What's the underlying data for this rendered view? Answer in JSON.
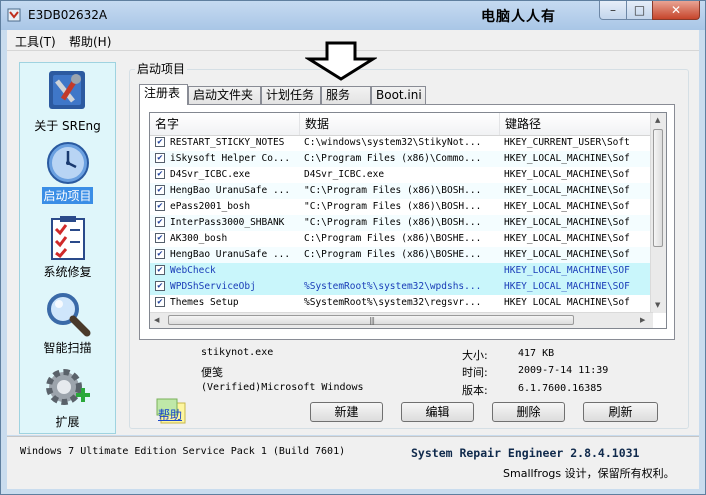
{
  "window": {
    "title": "E3DB02632A",
    "overlay_title": "电脑人人有",
    "min_glyph": "–",
    "max_glyph": "□",
    "close_glyph": "✕"
  },
  "menu": {
    "items": [
      "工具(T)",
      "帮助(H)"
    ]
  },
  "sidebar": {
    "items": [
      {
        "label": "关于 SREng",
        "icon": "tools-icon",
        "active": false
      },
      {
        "label": "启动项目",
        "icon": "clock-icon",
        "active": true
      },
      {
        "label": "系统修复",
        "icon": "checklist-icon",
        "active": false
      },
      {
        "label": "智能扫描",
        "icon": "magnifier-icon",
        "active": false
      },
      {
        "label": "扩展",
        "icon": "gear-plus-icon",
        "active": false
      }
    ]
  },
  "group": {
    "title": "启动项目"
  },
  "tabs": [
    {
      "label": "注册表",
      "active": true
    },
    {
      "label": "启动文件夹",
      "active": false
    },
    {
      "label": "计划任务",
      "active": false
    },
    {
      "label": "服务",
      "active": false
    },
    {
      "label": "Boot.ini",
      "active": false
    }
  ],
  "list": {
    "columns": [
      "名字",
      "数据",
      "键路径"
    ],
    "rows": [
      {
        "checked": true,
        "name": "RESTART_STICKY_NOTES",
        "data": "C:\\windows\\system32\\StikyNot...",
        "path": "HKEY_CURRENT_USER\\Soft",
        "style": "normal"
      },
      {
        "checked": true,
        "name": "iSkysoft Helper Co...",
        "data": "C:\\Program Files (x86)\\Commo...",
        "path": "HKEY_LOCAL_MACHINE\\Sof",
        "style": "alt"
      },
      {
        "checked": true,
        "name": "D4Svr_ICBC.exe",
        "data": "D4Svr_ICBC.exe",
        "path": "HKEY_LOCAL_MACHINE\\Sof",
        "style": "normal"
      },
      {
        "checked": true,
        "name": "HengBao UranuSafe ...",
        "data": "\"C:\\Program Files (x86)\\BOSH...",
        "path": "HKEY_LOCAL_MACHINE\\Sof",
        "style": "alt"
      },
      {
        "checked": true,
        "name": "ePass2001_bosh",
        "data": "\"C:\\Program Files (x86)\\BOSH...",
        "path": "HKEY_LOCAL_MACHINE\\Sof",
        "style": "normal"
      },
      {
        "checked": true,
        "name": "InterPass3000_SHBANK",
        "data": "\"C:\\Program Files (x86)\\BOSH...",
        "path": "HKEY_LOCAL_MACHINE\\Sof",
        "style": "alt"
      },
      {
        "checked": true,
        "name": "AK300_bosh",
        "data": "C:\\Program Files (x86)\\BOSHE...",
        "path": "HKEY_LOCAL_MACHINE\\Sof",
        "style": "normal"
      },
      {
        "checked": true,
        "name": "HengBao UranuSafe ...",
        "data": "C:\\Program Files (x86)\\BOSHE...",
        "path": "HKEY_LOCAL_MACHINE\\Sof",
        "style": "alt"
      },
      {
        "checked": true,
        "name": "WebCheck",
        "data": "",
        "path": "HKEY_LOCAL_MACHINE\\SOF",
        "style": "cyan-blue"
      },
      {
        "checked": true,
        "name": "WPDShServiceObj",
        "data": "%SystemRoot%\\system32\\wpdshs...",
        "path": "HKEY_LOCAL_MACHINE\\SOF",
        "style": "cyan-blue"
      },
      {
        "checked": true,
        "name": "Themes Setup",
        "data": "%SystemRoot%\\system32\\regsvr...",
        "path": "HKEY_LOCAL_MACHINE\\Sof",
        "style": "normal"
      }
    ]
  },
  "detail": {
    "file": "stikynot.exe",
    "description": "便笺",
    "signer": "(Verified)Microsoft Windows",
    "size_label": "大小:",
    "size_value": "417 KB",
    "time_label": "时间:",
    "time_value": "2009-7-14 11:39",
    "version_label": "版本:",
    "version_value": "6.1.7600.16385"
  },
  "actions": {
    "help": "帮助",
    "new": "新建",
    "edit": "编辑",
    "delete": "删除",
    "refresh": "刷新"
  },
  "status": {
    "os": "Windows 7 Ultimate Edition Service Pack 1 (Build 7601)",
    "product": "System Repair Engineer 2.8.4.1031",
    "copyright": "Smallfrogs 设计，保留所有权利。"
  },
  "colors": {
    "accent": "#3a8ee6",
    "sidebar_bg": "#dff6fa",
    "row_highlight": "#c9f6fb",
    "link": "#1a47c9"
  }
}
